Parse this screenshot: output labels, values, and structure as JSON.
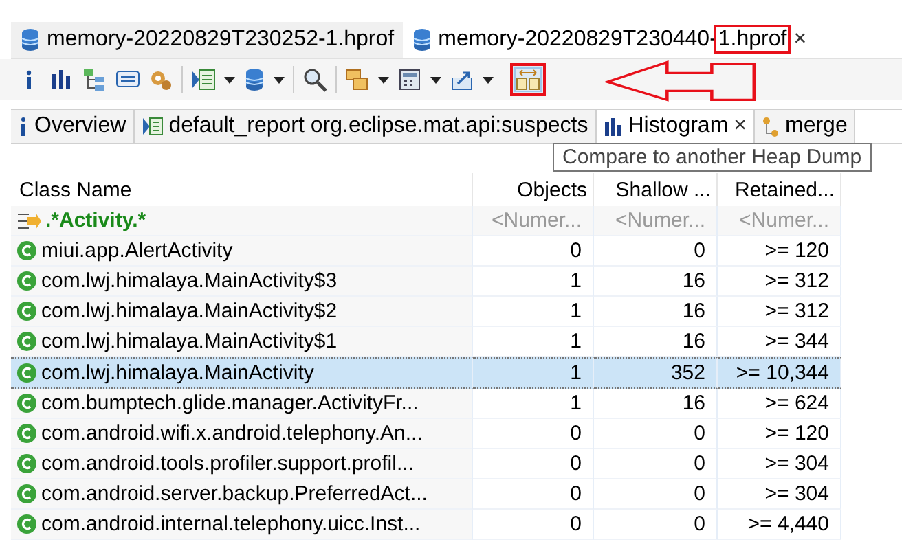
{
  "editor_tabs": [
    {
      "label": "memory-20220829T230252-1.hprof",
      "selected": false
    },
    {
      "label": "memory-20220829T230440-",
      "label_boxed": "1.hprof",
      "selected": true,
      "close": "×"
    }
  ],
  "toolbar": {
    "compare_button_highlighted": true
  },
  "tooltip": "Compare to another Heap Dump",
  "view_tabs": [
    {
      "kind": "info",
      "label": "Overview",
      "selected": false
    },
    {
      "kind": "report",
      "label": "default_report  org.eclipse.mat.api:suspects",
      "selected": false
    },
    {
      "kind": "chart",
      "label": "Histogram",
      "selected": true,
      "close": "×"
    },
    {
      "kind": "merge",
      "label": "merge",
      "selected": false
    }
  ],
  "table": {
    "columns": [
      "Class Name",
      "Objects",
      "Shallow ...",
      "Retained..."
    ],
    "filter": {
      "name": ".*Activity.*",
      "placeholders": [
        "<Numer...",
        "<Numer...",
        "<Numer..."
      ]
    },
    "rows": [
      {
        "name": "miui.app.AlertActivity",
        "objects": "0",
        "shallow": "0",
        "retained": ">= 120",
        "selected": false
      },
      {
        "name": "com.lwj.himalaya.MainActivity$3",
        "objects": "1",
        "shallow": "16",
        "retained": ">= 312",
        "selected": false
      },
      {
        "name": "com.lwj.himalaya.MainActivity$2",
        "objects": "1",
        "shallow": "16",
        "retained": ">= 312",
        "selected": false
      },
      {
        "name": "com.lwj.himalaya.MainActivity$1",
        "objects": "1",
        "shallow": "16",
        "retained": ">= 344",
        "selected": false
      },
      {
        "name": "com.lwj.himalaya.MainActivity",
        "objects": "1",
        "shallow": "352",
        "retained": ">= 10,344",
        "selected": true
      },
      {
        "name": "com.bumptech.glide.manager.ActivityFr...",
        "objects": "1",
        "shallow": "16",
        "retained": ">= 624",
        "selected": false
      },
      {
        "name": "com.android.wifi.x.android.telephony.An...",
        "objects": "0",
        "shallow": "0",
        "retained": ">= 120",
        "selected": false
      },
      {
        "name": "com.android.tools.profiler.support.profil...",
        "objects": "0",
        "shallow": "0",
        "retained": ">= 304",
        "selected": false
      },
      {
        "name": "com.android.server.backup.PreferredAct...",
        "objects": "0",
        "shallow": "0",
        "retained": ">= 304",
        "selected": false
      },
      {
        "name": "com.android.internal.telephony.uicc.Inst...",
        "objects": "0",
        "shallow": "0",
        "retained": ">= 4,440",
        "selected": false
      }
    ]
  }
}
